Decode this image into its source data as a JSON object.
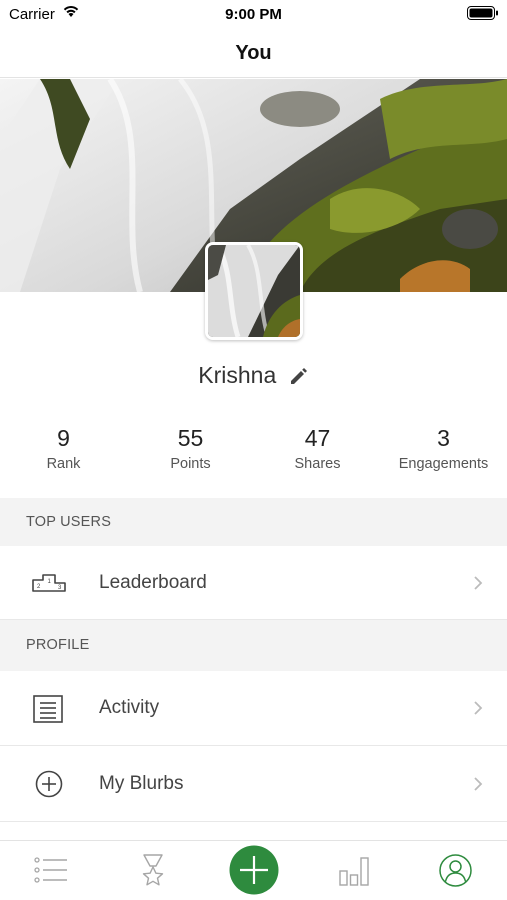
{
  "status_bar": {
    "carrier": "Carrier",
    "time": "9:00 PM"
  },
  "nav": {
    "title": "You"
  },
  "profile": {
    "name": "Krishna"
  },
  "stats": [
    {
      "value": "9",
      "label": "Rank"
    },
    {
      "value": "55",
      "label": "Points"
    },
    {
      "value": "47",
      "label": "Shares"
    },
    {
      "value": "3",
      "label": "Engagements"
    }
  ],
  "sections": {
    "top_users": {
      "header": "TOP USERS",
      "leaderboard_label": "Leaderboard"
    },
    "profile": {
      "header": "PROFILE",
      "activity_label": "Activity",
      "my_blurbs_label": "My Blurbs"
    }
  },
  "tab_bar": {
    "tabs": [
      {
        "icon": "list-icon",
        "active": false
      },
      {
        "icon": "badge-icon",
        "active": false
      },
      {
        "icon": "plus-icon",
        "active": false
      },
      {
        "icon": "bar-chart-icon",
        "active": false
      },
      {
        "icon": "profile-icon",
        "active": true
      }
    ]
  },
  "colors": {
    "accent": "#2e8b3e",
    "inactive_icon": "#a6a6a6",
    "section_background": "#f3f3f3"
  }
}
